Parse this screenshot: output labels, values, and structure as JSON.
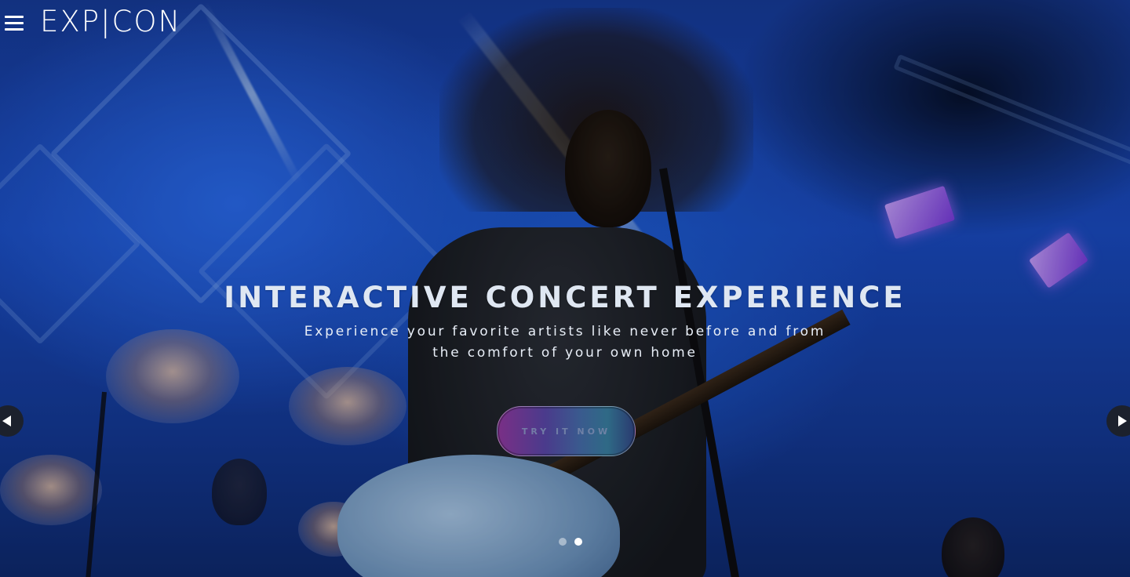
{
  "header": {
    "logo_text": "EXP|CON",
    "menu_icon": "hamburger-menu-icon"
  },
  "hero": {
    "headline": "INTERACTIVE CONCERT EXPERIENCE",
    "subtitle_line1": "Experience your favorite artists like never before and from",
    "subtitle_line2": "the comfort of your own home",
    "cta_label": "TRY IT NOW",
    "background_image": "rock singer with guitar on stage under blue lights"
  },
  "carousel": {
    "prev_icon": "arrow-left-icon",
    "next_icon": "arrow-right-icon",
    "slide_count": 2,
    "active_slide": 2
  },
  "colors": {
    "stage_blue": "#1a4cc4",
    "text_white": "#ffffff",
    "cta_gradient_start": "#7a2f86",
    "cta_gradient_end": "#2a3a70"
  }
}
